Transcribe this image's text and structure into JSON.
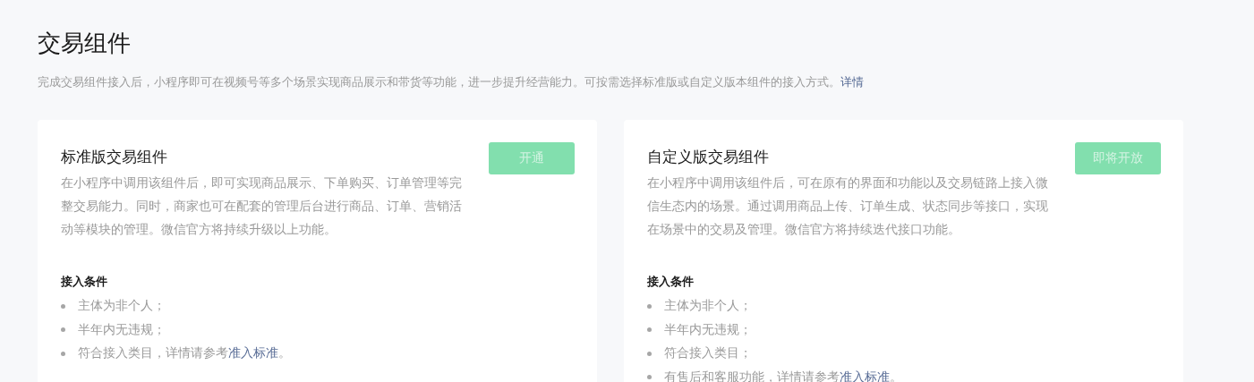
{
  "page": {
    "title": "交易组件",
    "intro": "完成交易组件接入后，小程序即可在视频号等多个场景实现商品展示和带货等功能，进一步提升经营能力。可按需选择标准版或自定义版本组件的接入方式。",
    "intro_link": "详情"
  },
  "cards": [
    {
      "title": "标准版交易组件",
      "button": {
        "label": "开通",
        "disabled": true
      },
      "description": "在小程序中调用该组件后，即可实现商品展示、下单购买、订单管理等完整交易能力。同时，商家也可在配套的管理后台进行商品、订单、营销活动等模块的管理。微信官方将持续升级以上功能。",
      "conditions_title": "接入条件",
      "conditions": [
        {
          "text": "主体为非个人；"
        },
        {
          "text": "半年内无违规；"
        },
        {
          "text": "符合接入类目，详情请参考",
          "link": "准入标准",
          "suffix": "。"
        }
      ]
    },
    {
      "title": "自定义版交易组件",
      "button": {
        "label": "即将开放",
        "disabled": true
      },
      "description": "在小程序中调用该组件后，可在原有的界面和功能以及交易链路上接入微信生态内的场景。通过调用商品上传、订单生成、状态同步等接口，实现在场景中的交易及管理。微信官方将持续迭代接口功能。",
      "conditions_title": "接入条件",
      "conditions": [
        {
          "text": "主体为非个人；"
        },
        {
          "text": "半年内无违规；"
        },
        {
          "text": "符合接入类目；"
        },
        {
          "text": "有售后和客服功能，详情请参考",
          "link": "准入标准",
          "suffix": "。"
        }
      ]
    }
  ]
}
